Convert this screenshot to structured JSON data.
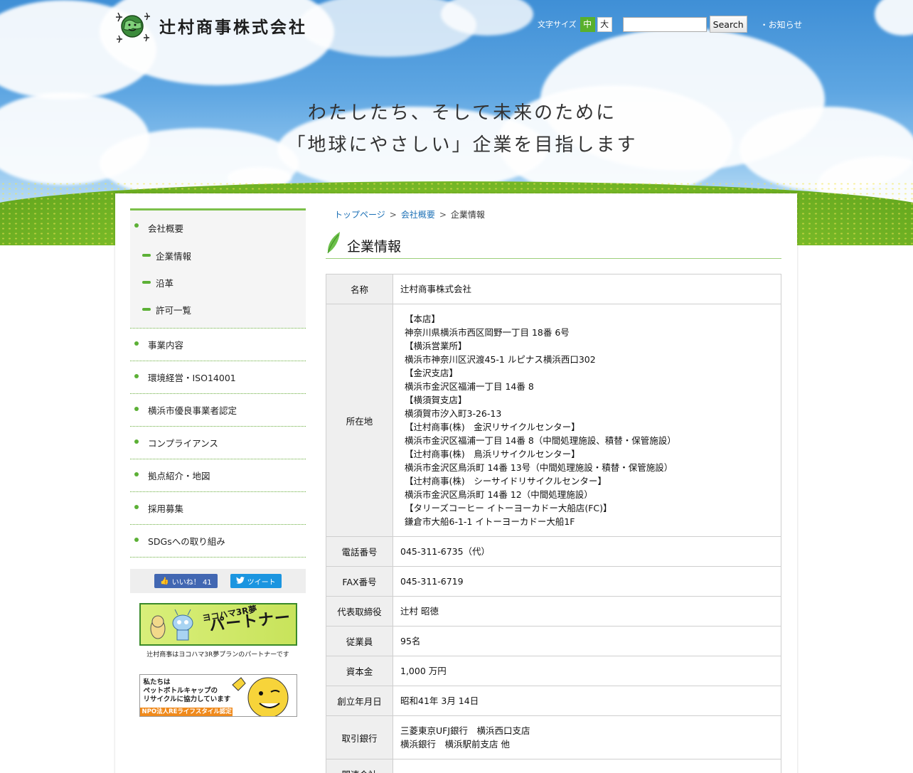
{
  "header": {
    "company_name": "辻村商事株式会社",
    "font_size_label": "文字サイズ",
    "font_size_medium": "中",
    "font_size_large": "大",
    "search_placeholder": "",
    "search_button": "Search",
    "news_link": "お知らせ"
  },
  "hero": {
    "tagline_1": "わたしたち、そして未来のために",
    "tagline_2": "「地球にやさしい」企業を目指します"
  },
  "sidebar": {
    "items": [
      {
        "label": "会社概要"
      },
      {
        "label": "事業内容"
      },
      {
        "label": "環境経営・ISO14001"
      },
      {
        "label": "横浜市優良事業者認定"
      },
      {
        "label": "コンプライアンス"
      },
      {
        "label": "拠点紹介・地図"
      },
      {
        "label": "採用募集"
      },
      {
        "label": "SDGsへの取り組み"
      }
    ],
    "subitems": [
      {
        "label": "企業情報"
      },
      {
        "label": "沿革"
      },
      {
        "label": "許可一覧"
      }
    ],
    "share": {
      "facebook_label": "いいね！ 41",
      "twitter_label": "ツイート"
    },
    "banner1": {
      "main_text": "パートナー",
      "small_text": "ヨコハマ3R夢",
      "caption": "辻村商事はヨコハマ3R夢プランのパートナーです"
    },
    "banner2": {
      "line1": "私たちは",
      "line2": "ペットボトルキャップの",
      "line3": "リサイクルに協力しています",
      "strip": "NPO法人REライフスタイル認定"
    }
  },
  "breadcrumb": {
    "home": "トップページ",
    "section": "会社概要",
    "current": "企業情報"
  },
  "page": {
    "title": "企業情報"
  },
  "company_info": {
    "name_label": "名称",
    "name_value": "辻村商事株式会社",
    "address_label": "所在地",
    "address_lines": [
      "【本店】",
      "神奈川県横浜市西区岡野一丁目 18番 6号",
      "【横浜営業所】",
      "横浜市神奈川区沢渡45-1 ルピナス横浜西口302",
      "【金沢支店】",
      "横浜市金沢区福浦一丁目 14番 8",
      "【横須賀支店】",
      "横須賀市汐入町3-26-13",
      "【辻村商事(株)　金沢リサイクルセンター】",
      "横浜市金沢区福浦一丁目 14番 8（中間処理施設、積替・保管施設）",
      "【辻村商事(株)　鳥浜リサイクルセンター】",
      "横浜市金沢区鳥浜町 14番 13号（中間処理施設・積替・保管施設）",
      "【辻村商事(株)　シーサイドリサイクルセンター】",
      "横浜市金沢区鳥浜町 14番 12（中間処理施設）",
      "【タリーズコーヒー イトーヨーカドー大船店(FC)】",
      "鎌倉市大船6-1-1 イトーヨーカドー大船1F"
    ],
    "phone_label": "電話番号",
    "phone_value": "045-311-6735（代）",
    "fax_label": "FAX番号",
    "fax_value": "045-311-6719",
    "ceo_label": "代表取締役",
    "ceo_value": "辻村 昭徳",
    "employees_label": "従業員",
    "employees_value": "95名",
    "capital_label": "資本金",
    "capital_value": "1,000 万円",
    "founded_label": "創立年月日",
    "founded_value": "昭和41年 3月 14日",
    "bank_label": "取引銀行",
    "bank_lines": [
      "三菱東京UFJ銀行　横浜西口支店",
      "横浜銀行　横浜駅前支店 他"
    ],
    "related_label": "関連会社",
    "related_value": ""
  },
  "colors": {
    "accent_green": "#5cb036",
    "link_blue": "#1a6fb5"
  }
}
